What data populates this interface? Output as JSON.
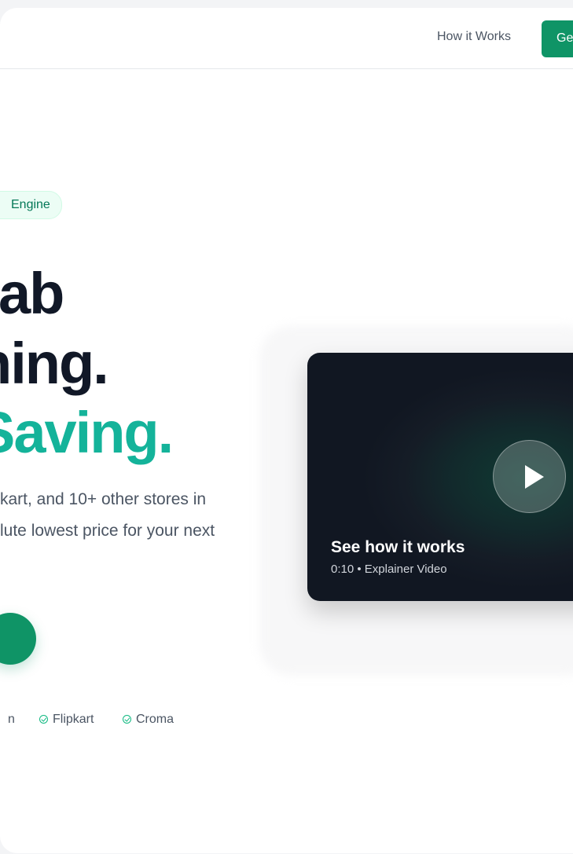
{
  "nav": {
    "how_it_works": "How it Works",
    "cta_label": "Ge"
  },
  "hero": {
    "badge": "Engine",
    "line1": "ab",
    "line2": "ning.",
    "line3": "Saving.",
    "sub1": "kart, and 10+ other stores in",
    "sub2": "lute lowest price for your next"
  },
  "stores": {
    "fragment": "n",
    "items": [
      "Flipkart",
      "Croma"
    ]
  },
  "video": {
    "title": "See how it works",
    "meta": "0:10 • Explainer Video"
  },
  "colors": {
    "brand_green": "#0f9466",
    "accent_teal": "#14b39a",
    "heading": "#111827"
  },
  "icons": {
    "store_check": "check-circle-icon",
    "play": "play-icon"
  }
}
